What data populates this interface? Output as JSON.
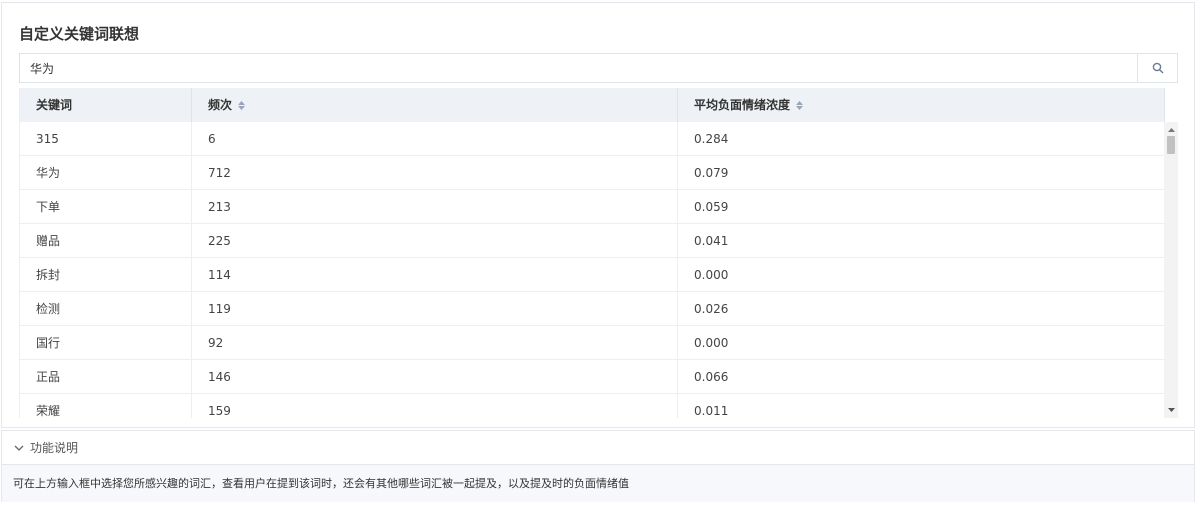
{
  "panel": {
    "title": "自定义关键词联想"
  },
  "search": {
    "value": "华为",
    "placeholder": ""
  },
  "table": {
    "columns": [
      {
        "label": "关键词",
        "sortable": false
      },
      {
        "label": "频次",
        "sortable": true
      },
      {
        "label": "平均负面情绪浓度",
        "sortable": true
      }
    ],
    "rows": [
      [
        "315",
        "6",
        "0.284"
      ],
      [
        "华为",
        "712",
        "0.079"
      ],
      [
        "下单",
        "213",
        "0.059"
      ],
      [
        "赠品",
        "225",
        "0.041"
      ],
      [
        "拆封",
        "114",
        "0.000"
      ],
      [
        "检测",
        "119",
        "0.026"
      ],
      [
        "国行",
        "92",
        "0.000"
      ],
      [
        "正品",
        "146",
        "0.066"
      ],
      [
        "荣耀",
        "159",
        "0.011"
      ]
    ]
  },
  "help": {
    "label": "功能说明",
    "text": "可在上方输入框中选择您所感兴趣的词汇，查看用户在提到该词时，还会有其他哪些词汇被一起提及，以及提及时的负面情绪值"
  },
  "icons": {
    "search": "search-icon",
    "sort": "sort-icon",
    "expand": "chevron-down-icon"
  },
  "colors": {
    "header_bg": "#eef1f6",
    "help_bg": "#f6f8fb",
    "border": "#e4e7ec"
  }
}
